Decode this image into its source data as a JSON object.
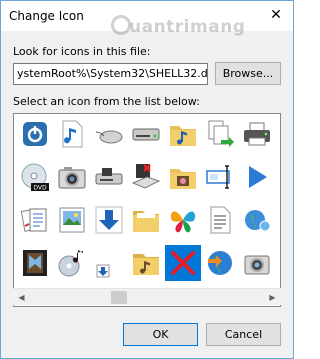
{
  "window": {
    "title": "Change Icon",
    "close_glyph": "✕"
  },
  "watermark": {
    "text": "uantrimang"
  },
  "file": {
    "label": "Look for icons in this file:",
    "path_value": "ystemRoot%\\System32\\SHELL32.dll",
    "browse_label": "Browse..."
  },
  "list": {
    "label": "Select an icon from the list below:",
    "icons": [
      "power-icon",
      "music-file-icon",
      "mouse-icon",
      "drive-icon",
      "music-folder-icon",
      "file-copy-icon",
      "printer-icon",
      "dvd-icon",
      "camera-icon",
      "floppy-drive-icon",
      "no-floppy-icon",
      "media-folder-icon",
      "window-select-icon",
      "play-arrow-icon",
      "documents-icon",
      "picture-frame-icon",
      "download-arrow-icon",
      "folder-icon",
      "msn-butterfly-icon",
      "text-file-icon",
      "network-globe-icon",
      "video-film-icon",
      "music-cd-icon",
      "download-small-icon",
      "music-folder-open-icon",
      "red-x-icon",
      "globe-arrow-icon",
      "webcam-icon"
    ],
    "selected_index": 25
  },
  "scrollbar": {
    "left_arrow": "◀",
    "right_arrow": "▶"
  },
  "buttons": {
    "ok": "OK",
    "cancel": "Cancel"
  },
  "colors": {
    "selection": "#0078d7",
    "window_border": "#6fa5d6"
  }
}
